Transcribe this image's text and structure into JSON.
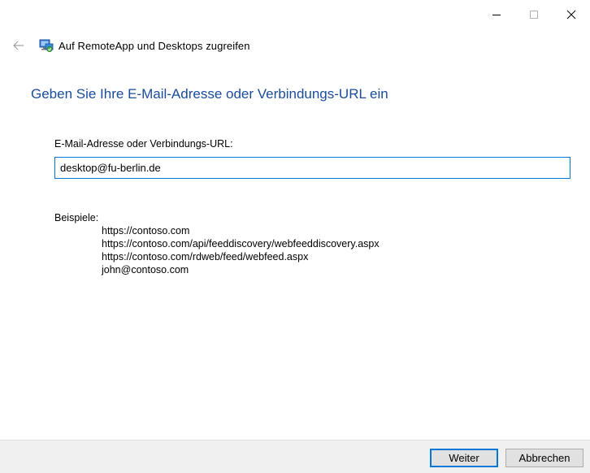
{
  "window": {
    "title": "Auf RemoteApp und Desktops zugreifen"
  },
  "main": {
    "heading": "Geben Sie Ihre E-Mail-Adresse oder Verbindungs-URL ein",
    "field_label": "E-Mail-Adresse oder Verbindungs-URL:",
    "field_value": "desktop@fu-berlin.de",
    "examples_title": "Beispiele:",
    "examples": [
      "https://contoso.com",
      "https://contoso.com/api/feeddiscovery/webfeeddiscovery.aspx",
      "https://contoso.com/rdweb/feed/webfeed.aspx",
      "john@contoso.com"
    ]
  },
  "footer": {
    "next_label": "Weiter",
    "cancel_label": "Abbrechen"
  },
  "icons": {
    "back": "arrow-left-icon",
    "app": "remote-desktop-icon",
    "minimize": "minimize-icon",
    "maximize": "maximize-icon",
    "close": "close-icon"
  },
  "colors": {
    "heading": "#1a4d9c",
    "focus_border": "#0078d7",
    "footer_bg": "#f0f0f0"
  }
}
